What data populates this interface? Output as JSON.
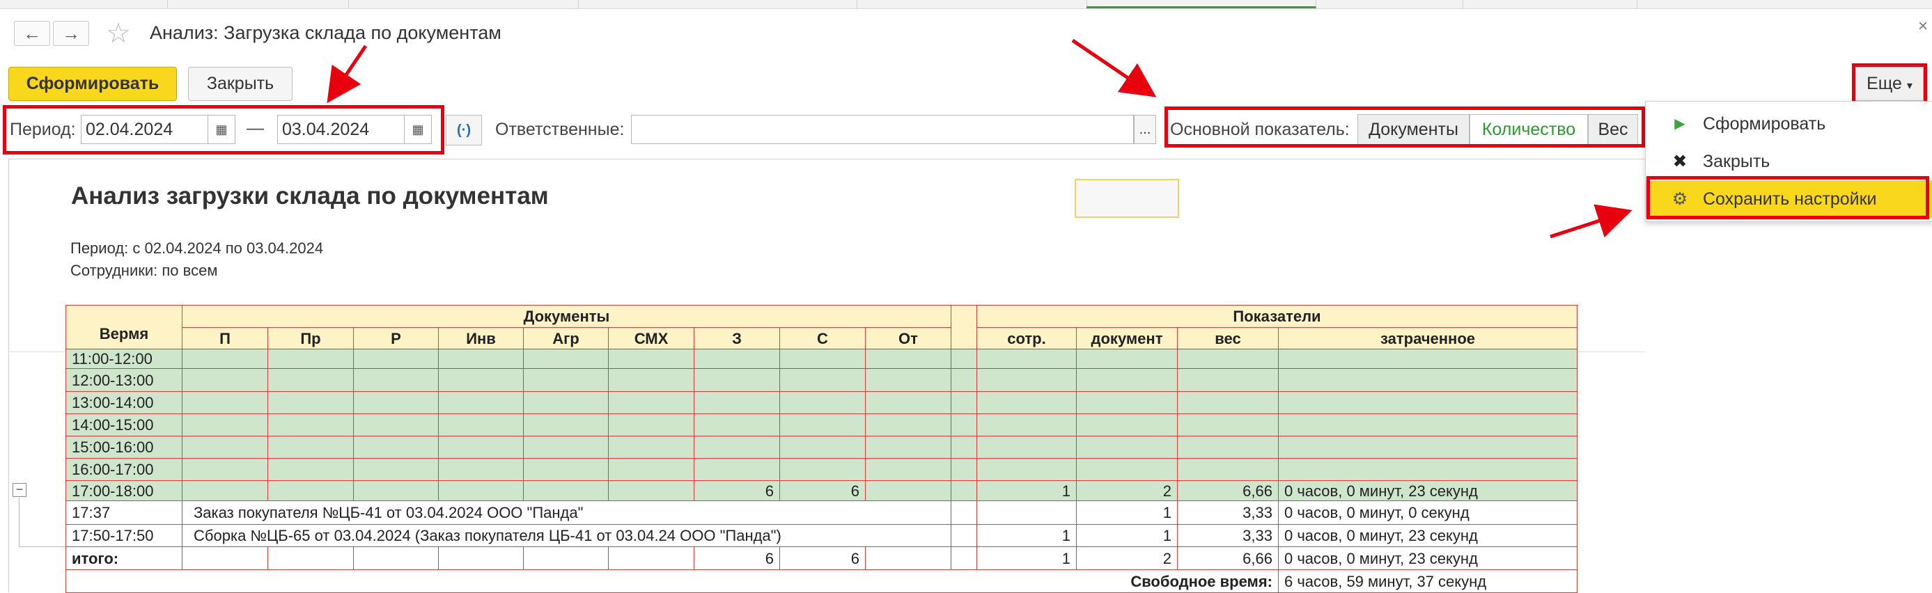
{
  "window": {
    "back_icon": "←",
    "forward_icon": "→",
    "favorite_icon": "☆",
    "title": "Анализ: Загрузка склада по документам",
    "close_icon": "×"
  },
  "toolbar": {
    "generate_label": "Сформировать",
    "close_label": "Закрыть",
    "more_label": "Еще",
    "more_chevron": "▾"
  },
  "filters": {
    "period_label": "Период:",
    "date_from": "02.04.2024",
    "dash": "—",
    "date_to": "03.04.2024",
    "calendar_icon": "▦",
    "period_select_icon": "(·)",
    "responsible_label": "Ответственные:",
    "responsible_value": "",
    "dots": "...",
    "main_indicator_label": "Основной показатель:",
    "indicator_options": [
      "Документы",
      "Количество",
      "Вес"
    ],
    "indicator_selected": "Количество"
  },
  "menu": {
    "items": [
      {
        "icon": "▶",
        "label": "Сформировать",
        "icon_color": "#3aa53a"
      },
      {
        "icon": "✖",
        "label": "Закрыть",
        "icon_color": "#222222"
      },
      {
        "icon": "⚙",
        "label": "Сохранить настройки",
        "icon_color": "#666666"
      }
    ]
  },
  "report": {
    "title": "Анализ загрузки склада по документам",
    "period_line": "Период: с 02.04.2024 по 03.04.2024",
    "staff_line": "Сотрудники: по всем",
    "collapse_icon": "−",
    "header": {
      "time": "Вермя",
      "documents_group": "Документы",
      "indicators_group": "Показатели",
      "doc_columns": [
        "П",
        "Пр",
        "Р",
        "Инв",
        "Агр",
        "СМХ",
        "З",
        "С",
        "От"
      ],
      "indicator_columns": [
        "сотр.",
        "документ",
        "вес",
        "затраченное"
      ]
    },
    "rows": [
      {
        "time": "11:00-12:00",
        "docs": [
          "",
          "",
          "",
          "",
          "",
          "",
          "",
          "",
          ""
        ],
        "staff": "",
        "doc": "",
        "weight": "",
        "spent": ""
      },
      {
        "time": "12:00-13:00",
        "docs": [
          "",
          "",
          "",
          "",
          "",
          "",
          "",
          "",
          ""
        ],
        "staff": "",
        "doc": "",
        "weight": "",
        "spent": ""
      },
      {
        "time": "13:00-14:00",
        "docs": [
          "",
          "",
          "",
          "",
          "",
          "",
          "",
          "",
          ""
        ],
        "staff": "",
        "doc": "",
        "weight": "",
        "spent": ""
      },
      {
        "time": "14:00-15:00",
        "docs": [
          "",
          "",
          "",
          "",
          "",
          "",
          "",
          "",
          ""
        ],
        "staff": "",
        "doc": "",
        "weight": "",
        "spent": ""
      },
      {
        "time": "15:00-16:00",
        "docs": [
          "",
          "",
          "",
          "",
          "",
          "",
          "",
          "",
          ""
        ],
        "staff": "",
        "doc": "",
        "weight": "",
        "spent": ""
      },
      {
        "time": "16:00-17:00",
        "docs": [
          "",
          "",
          "",
          "",
          "",
          "",
          "",
          "",
          ""
        ],
        "staff": "",
        "doc": "",
        "weight": "",
        "spent": ""
      },
      {
        "time": "17:00-18:00",
        "docs": [
          "",
          "",
          "",
          "",
          "",
          "",
          "6",
          "6",
          ""
        ],
        "staff": "1",
        "doc": "2",
        "weight": "6,66",
        "spent": "0 часов, 0 минут, 23 секунд"
      }
    ],
    "detail_rows": [
      {
        "time": "17:37",
        "text": "Заказ покупателя №ЦБ-41 от 03.04.2024 ООО \"Панда\"",
        "staff": "",
        "doc": "1",
        "weight": "3,33",
        "spent": "0 часов, 0 минут, 0 секунд"
      },
      {
        "time": "17:50-17:50",
        "text": "Сборка №ЦБ-65 от 03.04.2024 (Заказ покупателя ЦБ-41 от 03.04.24 ООО \"Панда\")",
        "staff": "1",
        "doc": "1",
        "weight": "3,33",
        "spent": "0 часов, 0 минут, 23 секунд"
      }
    ],
    "total": {
      "label": "итого:",
      "docs": [
        "",
        "",
        "",
        "",
        "",
        "",
        "6",
        "6",
        ""
      ],
      "staff": "1",
      "doc": "2",
      "weight": "6,66",
      "spent": "0 часов, 0 минут, 23 секунд"
    },
    "free_time": {
      "label": "Свободное время:",
      "value": "6 часов, 59 минут, 37 секунд"
    }
  },
  "colors": {
    "accent_yellow": "#f9d71c",
    "annotation_red": "#e8000e",
    "grid_red": "#e23a3a",
    "header_fill": "#fdf3c6",
    "row_green": "#cfe5cc",
    "selected_green_text": "#2e9a2e"
  }
}
